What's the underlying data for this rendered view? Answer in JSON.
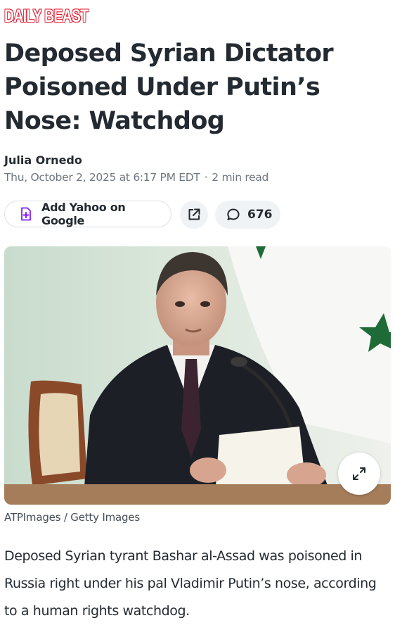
{
  "brand": {
    "logo_text": "DAILY BEAST",
    "logo_color": "#e3172b"
  },
  "article": {
    "headline": "Deposed Syrian Dictator Poisoned Under Putin’s Nose: Watchdog",
    "author": "Julia Ornedo",
    "date": "Thu, October 2, 2025 at 6:17 PM EDT",
    "read_time": "2 min read",
    "body": "Deposed Syrian tyrant Bashar al-Assad was poisoned in Russia right under his pal Vladimir Putin’s nose, according to a human rights watchdog."
  },
  "actions": {
    "add_yahoo_label": "Add Yahoo on Google",
    "share_icon": "share-external-icon",
    "comment_count": "676",
    "comment_icon": "comment-bubble-icon"
  },
  "media": {
    "caption": "ATPImages / Getty Images",
    "expand_icon": "expand-arrows-icon"
  },
  "colors": {
    "text": "#232a31",
    "meta": "#6e7780",
    "accent_purple": "#7e1fff",
    "chip_bg": "#f0f3f5"
  }
}
